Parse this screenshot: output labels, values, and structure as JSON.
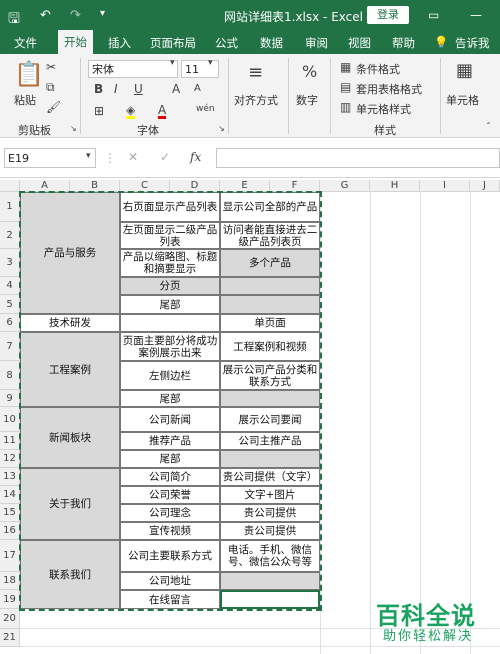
{
  "window": {
    "title": "网站详细表1.xlsx - Excel",
    "login_label": "登录"
  },
  "tabs": [
    "文件",
    "开始",
    "插入",
    "页面布局",
    "公式",
    "数据",
    "审阅",
    "视图",
    "帮助",
    "告诉我"
  ],
  "ribbon": {
    "paste_label": "粘贴",
    "clipboard_group": "剪贴板",
    "font_name": "宋体",
    "font_size": "11",
    "font_group": "字体",
    "align_label": "对齐方式",
    "number_label": "数字",
    "cond_format": "条件格式",
    "table_format": "套用表格格式",
    "cell_style": "单元格样式",
    "style_group": "样式",
    "cells_label": "单元格"
  },
  "formula_bar": {
    "name_box": "E19",
    "fx": "fx"
  },
  "columns": [
    "A",
    "B",
    "C",
    "D",
    "E",
    "F",
    "G",
    "H",
    "I",
    "J"
  ],
  "rows": [
    "1",
    "2",
    "3",
    "4",
    "5",
    "6",
    "7",
    "8",
    "9",
    "10",
    "11",
    "12",
    "13",
    "14",
    "15",
    "16",
    "17",
    "18",
    "19",
    "20",
    "21"
  ],
  "cells": {
    "a_products": "产品与服务",
    "a_tech": "技术研发",
    "a_cases": "工程案例",
    "a_news": "新闻板块",
    "a_about": "关于我们",
    "a_contact": "联系我们",
    "c1": "右页面显示产品列表",
    "e1": "显示公司全部的产品",
    "c2": "左页面显示二级产品列表",
    "e2": "访问者能直接进去二级产品列表页",
    "c3": "产品以缩略图、标题和摘要显示",
    "e3": "多个产品",
    "c4": "分页",
    "c5": "尾部",
    "e6": "单页面",
    "c7": "页面主要部分将成功案例展示出来",
    "e7": "工程案例和视频",
    "c8": "左侧边栏",
    "e8": "展示公司产品分类和联系方式",
    "c9": "尾部",
    "c11": "公司新闻",
    "e11": "展示公司要闻",
    "c12": "推荐产品",
    "e12": "公司主推产品",
    "c13": "尾部",
    "c14": "公司简介",
    "e14": "贵公司提供（文字）",
    "c15": "公司荣誉",
    "e15": "文字+图片",
    "c16a": "公司理念",
    "e16a": "贵公司提供",
    "c16b": "宣传视频",
    "e16b": "贵公司提供",
    "c17": "公司主要联系方式",
    "e17": "电话。手机、微信号、微信公众号等",
    "c18": "公司地址",
    "c19": "在线留言"
  },
  "watermark": {
    "brand": "百科全说",
    "slogan": "助你轻松解决"
  },
  "colors": {
    "excel_green": "#217346",
    "gray_fill": "#d9d9d9",
    "watermark_green": "#1aa260"
  }
}
